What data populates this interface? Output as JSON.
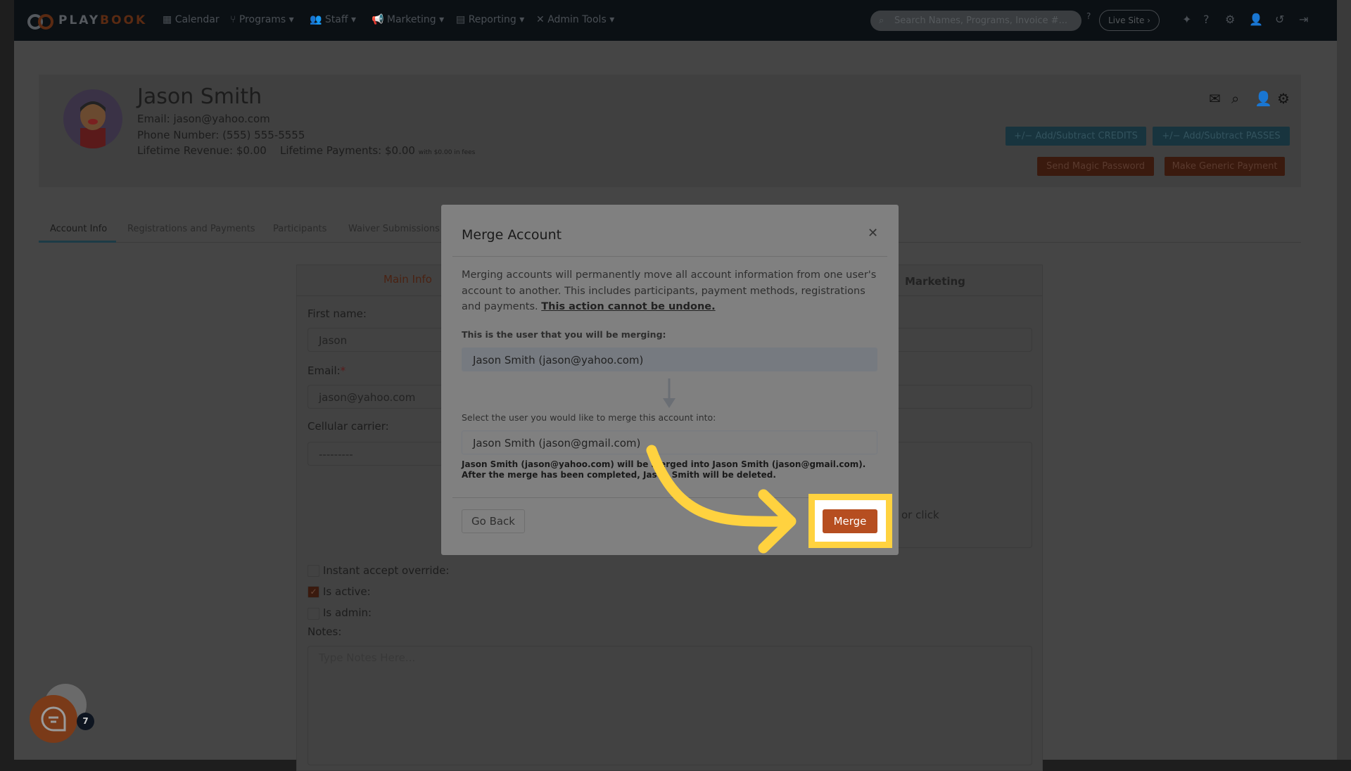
{
  "nav": {
    "logo_play": "PLAY",
    "logo_book": "BOOK",
    "items": [
      {
        "label": "Calendar",
        "icon": "calendar-icon"
      },
      {
        "label": "Programs",
        "icon": "branch-icon"
      },
      {
        "label": "Staff",
        "icon": "users-icon"
      },
      {
        "label": "Marketing",
        "icon": "megaphone-icon"
      },
      {
        "label": "Reporting",
        "icon": "document-icon"
      },
      {
        "label": "Admin Tools",
        "icon": "tools-icon"
      }
    ],
    "search_placeholder": "Search Names, Programs, Invoice #...",
    "live_site": "Live Site"
  },
  "profile": {
    "name": "Jason Smith",
    "email_label": "Email:",
    "email": "jason@yahoo.com",
    "phone_label": "Phone Number:",
    "phone": "(555) 555-5555",
    "revenue_label": "Lifetime Revenue:",
    "revenue": "$0.00",
    "payments_label": "Lifetime Payments:",
    "payments": "$0.00",
    "fees_note": "with $0.00 in fees",
    "buttons": {
      "credits": "Add/Subtract CREDITS",
      "passes": "Add/Subtract PASSES",
      "magic": "Send Magic Password",
      "generic": "Make Generic Payment",
      "plusminus": "+/−"
    }
  },
  "tabs": [
    "Account Info",
    "Registrations and Payments",
    "Participants",
    "Waiver Submissions"
  ],
  "form": {
    "section_main": "Main Info",
    "section_marketing": "Marketing",
    "first_name_label": "First name:",
    "first_name": "Jason",
    "email_label": "Email:",
    "required": "*",
    "email": "jason@yahoo.com",
    "carrier_label": "Cellular carrier:",
    "carrier": "---------",
    "upload_hint": "or click",
    "instant_accept": "Instant accept override:",
    "is_active": "Is active:",
    "is_admin": "Is admin:",
    "is_active_checked": true,
    "notes_label": "Notes:",
    "notes_placeholder": "Type Notes Here..."
  },
  "modal": {
    "title": "Merge Account",
    "description": "Merging accounts will permanently move all account information from one user's account to another. This includes participants, payment methods, registrations and payments. ",
    "warning": "This action cannot be undone.",
    "source_label": "This is the user that you will be merging:",
    "source_value": "Jason Smith (jason@yahoo.com)",
    "target_label": "Select the user you would like to merge this account into:",
    "target_value": "Jason Smith (jason@gmail.com)",
    "note": "Jason Smith (jason@yahoo.com) will be merged into Jason Smith (jason@gmail.com). After the merge has been completed, Jason Smith will be deleted.",
    "go_back": "Go Back",
    "merge": "Merge"
  },
  "chat": {
    "badge": "7"
  },
  "colors": {
    "accent": "#b64e20",
    "highlight": "#ffd23f",
    "nav": "#0b1014",
    "blue": "#18343e"
  }
}
